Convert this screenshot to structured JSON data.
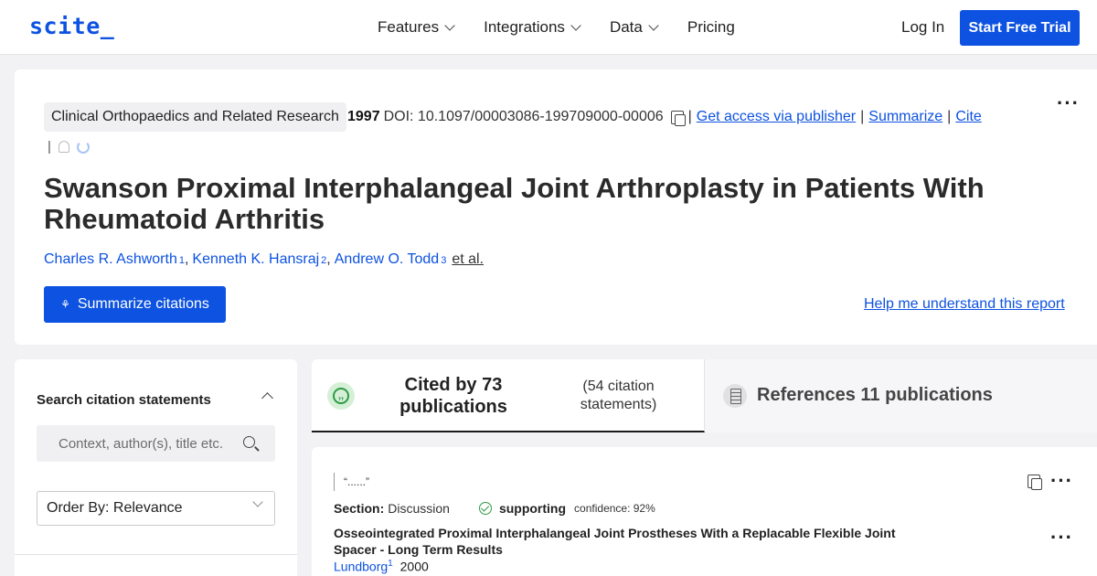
{
  "nav": {
    "logo": "scite_",
    "menu": [
      {
        "label": "Features",
        "dropdown": true
      },
      {
        "label": "Integrations",
        "dropdown": true
      },
      {
        "label": "Data",
        "dropdown": true
      },
      {
        "label": "Pricing",
        "dropdown": false
      }
    ],
    "login": "Log In",
    "trial": "Start Free Trial"
  },
  "paper": {
    "journal": "Clinical Orthopaedics and Related Research",
    "year": "1997",
    "doi": "DOI: 10.1097/00003086-199709000-00006",
    "links": [
      "Get access via publisher",
      "Summarize",
      "Cite"
    ],
    "title": "Swanson Proximal Interphalangeal Joint Arthroplasty in Patients With Rheumatoid Arthritis",
    "authors": [
      {
        "name": "Charles R. Ashworth",
        "sup": "1"
      },
      {
        "name": "Kenneth K. Hansraj",
        "sup": "2"
      },
      {
        "name": "Andrew O. Todd",
        "sup": "3"
      }
    ],
    "et_al": "et al.",
    "summarize_btn": "Summarize citations",
    "help_link": "Help me understand this report"
  },
  "sidebar": {
    "heading": "Search citation statements",
    "search_placeholder": "Context, author(s), title etc.",
    "order_by": "Order By: Relevance"
  },
  "tabs": {
    "cited_by": "Cited by 73 publications",
    "cited_statements": "(54 citation statements)",
    "references": "References 11 publications"
  },
  "citation": {
    "quote": "“......”",
    "section_label": "Section:",
    "section_value": "Discussion",
    "type": "supporting",
    "confidence": "confidence: 92%",
    "title": "Osseointegrated Proximal Interphalangeal Joint Prostheses With a Replacable Flexible Joint Spacer - Long Term Results",
    "author": "Lundborg",
    "author_sup": "1",
    "year": "2000"
  },
  "colors": {
    "brand": "#0d52e0",
    "supporting": "#2e9a45"
  }
}
